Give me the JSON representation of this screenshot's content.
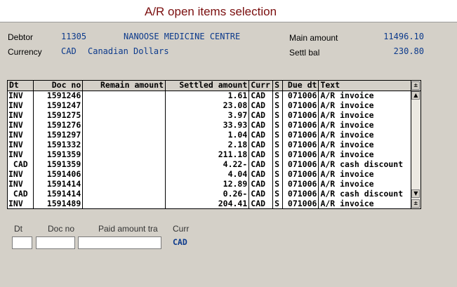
{
  "header": {
    "title": "A/R open items selection"
  },
  "info": {
    "debtor_label": "Debtor",
    "debtor_code": "11305",
    "debtor_name": "NANOOSE MEDICINE CENTRE",
    "currency_label": "Currency",
    "currency_code": "CAD",
    "currency_name": "Canadian Dollars",
    "main_amount_label": "Main amount",
    "main_amount_value": "11496.10",
    "settl_bal_label": "Settl bal",
    "settl_bal_value": "230.80"
  },
  "table": {
    "columns": {
      "dt": "Dt",
      "doc_no": "Doc no",
      "remain": "Remain amount",
      "settled": "Settled amount",
      "curr": "Curr",
      "s": "S",
      "due": "Due dt",
      "text": "Text"
    },
    "scroll_up_glyph": "▲",
    "scroll_down_glyph": "▼",
    "scroll_both_glyph": "±",
    "rows": [
      {
        "dt": "INV",
        "doc": "1591246",
        "remain": "",
        "settled": "1.61",
        "curr": "CAD",
        "s": "S",
        "due": "071006",
        "text": "A/R invoice"
      },
      {
        "dt": "INV",
        "doc": "1591247",
        "remain": "",
        "settled": "23.08",
        "curr": "CAD",
        "s": "S",
        "due": "071006",
        "text": "A/R invoice"
      },
      {
        "dt": "INV",
        "doc": "1591275",
        "remain": "",
        "settled": "3.97",
        "curr": "CAD",
        "s": "S",
        "due": "071006",
        "text": "A/R invoice"
      },
      {
        "dt": "INV",
        "doc": "1591276",
        "remain": "",
        "settled": "33.93",
        "curr": "CAD",
        "s": "S",
        "due": "071006",
        "text": "A/R invoice"
      },
      {
        "dt": "INV",
        "doc": "1591297",
        "remain": "",
        "settled": "1.04",
        "curr": "CAD",
        "s": "S",
        "due": "071006",
        "text": "A/R invoice"
      },
      {
        "dt": "INV",
        "doc": "1591332",
        "remain": "",
        "settled": "2.18",
        "curr": "CAD",
        "s": "S",
        "due": "071006",
        "text": "A/R invoice"
      },
      {
        "dt": "INV",
        "doc": "1591359",
        "remain": "",
        "settled": "211.18",
        "curr": "CAD",
        "s": "S",
        "due": "071006",
        "text": "A/R invoice"
      },
      {
        "dt": " CAD",
        "doc": "1591359",
        "remain": "",
        "settled": "4.22-",
        "curr": "CAD",
        "s": "S",
        "due": "071006",
        "text": "A/R cash discount"
      },
      {
        "dt": "INV",
        "doc": "1591406",
        "remain": "",
        "settled": "4.04",
        "curr": "CAD",
        "s": "S",
        "due": "071006",
        "text": "A/R invoice"
      },
      {
        "dt": "INV",
        "doc": "1591414",
        "remain": "",
        "settled": "12.89",
        "curr": "CAD",
        "s": "S",
        "due": "071006",
        "text": "A/R invoice"
      },
      {
        "dt": " CAD",
        "doc": "1591414",
        "remain": "",
        "settled": "0.26-",
        "curr": "CAD",
        "s": "S",
        "due": "071006",
        "text": "A/R cash discount"
      },
      {
        "dt": "INV",
        "doc": "1591489",
        "remain": "",
        "settled": "204.41",
        "curr": "CAD",
        "s": "S",
        "due": "071006",
        "text": "A/R invoice"
      }
    ]
  },
  "entry": {
    "dt_label": "Dt",
    "doc_label": "Doc no",
    "paid_label": "Paid amount tra",
    "curr_label": "Curr",
    "curr_value": "CAD",
    "dt_value": "",
    "doc_value": "",
    "paid_value": ""
  }
}
